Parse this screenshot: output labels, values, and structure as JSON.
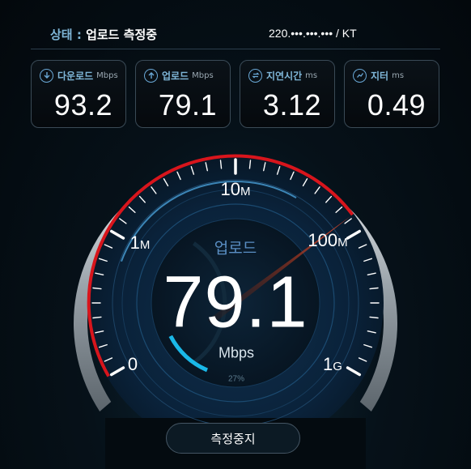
{
  "status": {
    "label": "상태 :",
    "value": "업로드 측정중"
  },
  "isp": {
    "text": "220.•••.•••.••• / KT"
  },
  "cards": {
    "download": {
      "title": "다운로드",
      "unit": "Mbps",
      "value": "93.2"
    },
    "upload": {
      "title": "업로드",
      "unit": "Mbps",
      "value": "79.1"
    },
    "latency": {
      "title": "지연시간",
      "unit": "ms",
      "value": "3.12"
    },
    "jitter": {
      "title": "지터",
      "unit": "ms",
      "value": "0.49"
    }
  },
  "gauge": {
    "mode": "업로드",
    "value": "79.1",
    "unit": "Mbps",
    "progress": "27%",
    "progress_fraction": 0.27,
    "labels": {
      "zero": "0",
      "one_m": "1",
      "ten_m": "10",
      "hundred_m": "100",
      "one_g": "1",
      "m_suffix": "M",
      "g_suffix": "G"
    }
  },
  "actions": {
    "stop_label": "측정중지"
  },
  "colors": {
    "accent_red": "#d8151c",
    "accent_blue": "#4aa0d8",
    "progress_cyan": "#1ab8e8"
  }
}
